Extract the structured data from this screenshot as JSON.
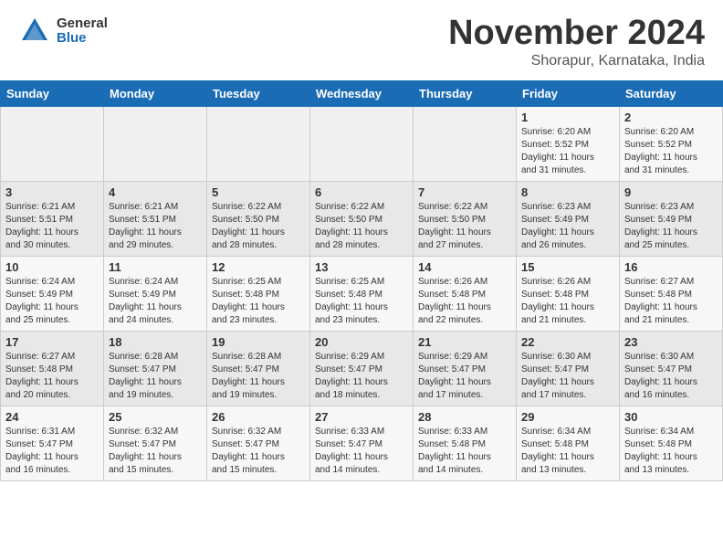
{
  "logo": {
    "general": "General",
    "blue": "Blue"
  },
  "title": "November 2024",
  "location": "Shorapur, Karnataka, India",
  "weekdays": [
    "Sunday",
    "Monday",
    "Tuesday",
    "Wednesday",
    "Thursday",
    "Friday",
    "Saturday"
  ],
  "weeks": [
    [
      {
        "day": "",
        "info": ""
      },
      {
        "day": "",
        "info": ""
      },
      {
        "day": "",
        "info": ""
      },
      {
        "day": "",
        "info": ""
      },
      {
        "day": "",
        "info": ""
      },
      {
        "day": "1",
        "info": "Sunrise: 6:20 AM\nSunset: 5:52 PM\nDaylight: 11 hours\nand 31 minutes."
      },
      {
        "day": "2",
        "info": "Sunrise: 6:20 AM\nSunset: 5:52 PM\nDaylight: 11 hours\nand 31 minutes."
      }
    ],
    [
      {
        "day": "3",
        "info": "Sunrise: 6:21 AM\nSunset: 5:51 PM\nDaylight: 11 hours\nand 30 minutes."
      },
      {
        "day": "4",
        "info": "Sunrise: 6:21 AM\nSunset: 5:51 PM\nDaylight: 11 hours\nand 29 minutes."
      },
      {
        "day": "5",
        "info": "Sunrise: 6:22 AM\nSunset: 5:50 PM\nDaylight: 11 hours\nand 28 minutes."
      },
      {
        "day": "6",
        "info": "Sunrise: 6:22 AM\nSunset: 5:50 PM\nDaylight: 11 hours\nand 28 minutes."
      },
      {
        "day": "7",
        "info": "Sunrise: 6:22 AM\nSunset: 5:50 PM\nDaylight: 11 hours\nand 27 minutes."
      },
      {
        "day": "8",
        "info": "Sunrise: 6:23 AM\nSunset: 5:49 PM\nDaylight: 11 hours\nand 26 minutes."
      },
      {
        "day": "9",
        "info": "Sunrise: 6:23 AM\nSunset: 5:49 PM\nDaylight: 11 hours\nand 25 minutes."
      }
    ],
    [
      {
        "day": "10",
        "info": "Sunrise: 6:24 AM\nSunset: 5:49 PM\nDaylight: 11 hours\nand 25 minutes."
      },
      {
        "day": "11",
        "info": "Sunrise: 6:24 AM\nSunset: 5:49 PM\nDaylight: 11 hours\nand 24 minutes."
      },
      {
        "day": "12",
        "info": "Sunrise: 6:25 AM\nSunset: 5:48 PM\nDaylight: 11 hours\nand 23 minutes."
      },
      {
        "day": "13",
        "info": "Sunrise: 6:25 AM\nSunset: 5:48 PM\nDaylight: 11 hours\nand 23 minutes."
      },
      {
        "day": "14",
        "info": "Sunrise: 6:26 AM\nSunset: 5:48 PM\nDaylight: 11 hours\nand 22 minutes."
      },
      {
        "day": "15",
        "info": "Sunrise: 6:26 AM\nSunset: 5:48 PM\nDaylight: 11 hours\nand 21 minutes."
      },
      {
        "day": "16",
        "info": "Sunrise: 6:27 AM\nSunset: 5:48 PM\nDaylight: 11 hours\nand 21 minutes."
      }
    ],
    [
      {
        "day": "17",
        "info": "Sunrise: 6:27 AM\nSunset: 5:48 PM\nDaylight: 11 hours\nand 20 minutes."
      },
      {
        "day": "18",
        "info": "Sunrise: 6:28 AM\nSunset: 5:47 PM\nDaylight: 11 hours\nand 19 minutes."
      },
      {
        "day": "19",
        "info": "Sunrise: 6:28 AM\nSunset: 5:47 PM\nDaylight: 11 hours\nand 19 minutes."
      },
      {
        "day": "20",
        "info": "Sunrise: 6:29 AM\nSunset: 5:47 PM\nDaylight: 11 hours\nand 18 minutes."
      },
      {
        "day": "21",
        "info": "Sunrise: 6:29 AM\nSunset: 5:47 PM\nDaylight: 11 hours\nand 17 minutes."
      },
      {
        "day": "22",
        "info": "Sunrise: 6:30 AM\nSunset: 5:47 PM\nDaylight: 11 hours\nand 17 minutes."
      },
      {
        "day": "23",
        "info": "Sunrise: 6:30 AM\nSunset: 5:47 PM\nDaylight: 11 hours\nand 16 minutes."
      }
    ],
    [
      {
        "day": "24",
        "info": "Sunrise: 6:31 AM\nSunset: 5:47 PM\nDaylight: 11 hours\nand 16 minutes."
      },
      {
        "day": "25",
        "info": "Sunrise: 6:32 AM\nSunset: 5:47 PM\nDaylight: 11 hours\nand 15 minutes."
      },
      {
        "day": "26",
        "info": "Sunrise: 6:32 AM\nSunset: 5:47 PM\nDaylight: 11 hours\nand 15 minutes."
      },
      {
        "day": "27",
        "info": "Sunrise: 6:33 AM\nSunset: 5:47 PM\nDaylight: 11 hours\nand 14 minutes."
      },
      {
        "day": "28",
        "info": "Sunrise: 6:33 AM\nSunset: 5:48 PM\nDaylight: 11 hours\nand 14 minutes."
      },
      {
        "day": "29",
        "info": "Sunrise: 6:34 AM\nSunset: 5:48 PM\nDaylight: 11 hours\nand 13 minutes."
      },
      {
        "day": "30",
        "info": "Sunrise: 6:34 AM\nSunset: 5:48 PM\nDaylight: 11 hours\nand 13 minutes."
      }
    ]
  ]
}
